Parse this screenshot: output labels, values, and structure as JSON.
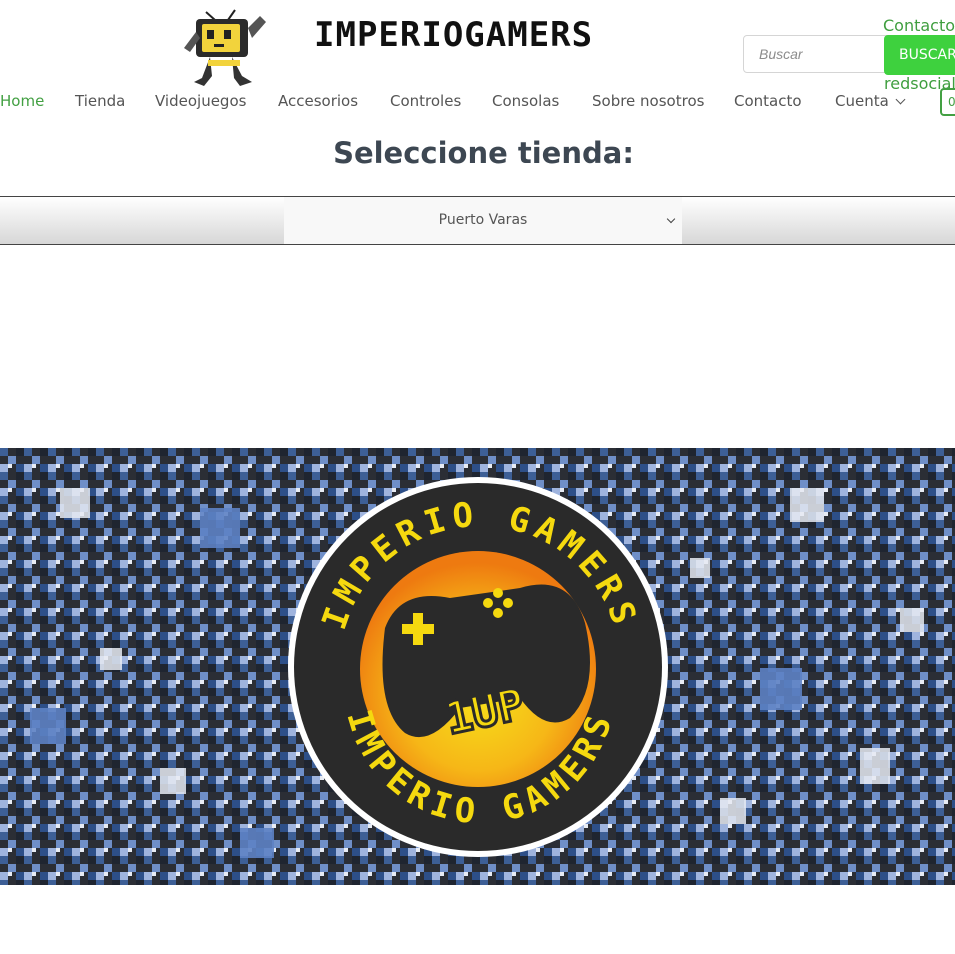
{
  "header": {
    "brand": "IMPERIOGAMERS",
    "top_links": {
      "contact": "Contacto",
      "social": "redsocial"
    },
    "search": {
      "placeholder": "Buscar",
      "button_label": "BUSCAR"
    },
    "cart_label": "0",
    "logo_icon": "tv-robot-mascot-icon"
  },
  "nav": {
    "items": [
      {
        "label": "Home",
        "active": true
      },
      {
        "label": "Tienda"
      },
      {
        "label": "Videojuegos"
      },
      {
        "label": "Accesorios"
      },
      {
        "label": "Controles"
      },
      {
        "label": "Consolas"
      },
      {
        "label": "Sobre nosotros"
      },
      {
        "label": "Contacto"
      },
      {
        "label": "Cuenta",
        "has_dropdown": true
      }
    ]
  },
  "store_select": {
    "title": "Seleccione tienda:",
    "selected": "Puerto Varas"
  },
  "banner": {
    "ring_text_top": "IMPERIO GAMERS",
    "ring_text_bottom": "IMPERIO GAMERS",
    "badge_text": "1UP",
    "controller_icon": "gamepad-icon"
  },
  "colors": {
    "accent_green": "#3ed13e",
    "link_green": "#43a043",
    "title": "#3d4752",
    "banner_yellow": "#f5d90f",
    "banner_orange": "#f08a12"
  }
}
